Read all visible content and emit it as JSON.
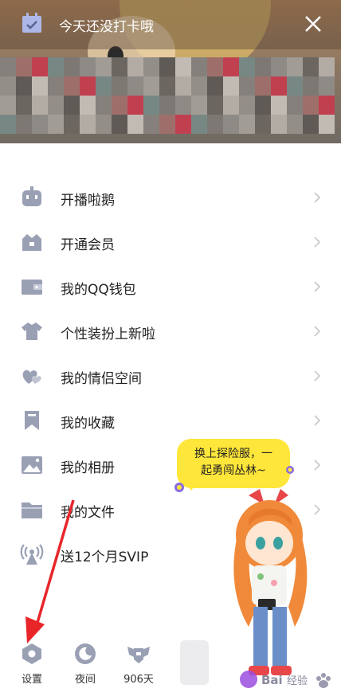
{
  "checkin_banner": {
    "text": "今天还没打卡哦",
    "close_icon": "close-icon"
  },
  "menu": {
    "items": [
      {
        "label": "开播啦鹅",
        "icon": "live-robot-icon"
      },
      {
        "label": "开通会员",
        "icon": "crown-icon"
      },
      {
        "label": "我的QQ钱包",
        "icon": "wallet-icon"
      },
      {
        "label": "个性装扮上新啦",
        "icon": "shirt-icon"
      },
      {
        "label": "我的情侣空间",
        "icon": "hearts-icon"
      },
      {
        "label": "我的收藏",
        "icon": "bookmark-icon"
      },
      {
        "label": "我的相册",
        "icon": "photo-icon"
      },
      {
        "label": "我的文件",
        "icon": "folder-icon"
      },
      {
        "label": "送12个月SVIP",
        "icon": "broadcast-icon"
      }
    ]
  },
  "promo": {
    "bubble_line1": "换上探险服，一",
    "bubble_line2": "起勇闯丛林~"
  },
  "bottom_nav": {
    "settings": "设置",
    "night": "夜间",
    "days": "906天"
  },
  "colors": {
    "icon_gray": "#9aa0b4",
    "bubble_yellow": "#ffe63a",
    "arrow_red": "#e8262a"
  }
}
